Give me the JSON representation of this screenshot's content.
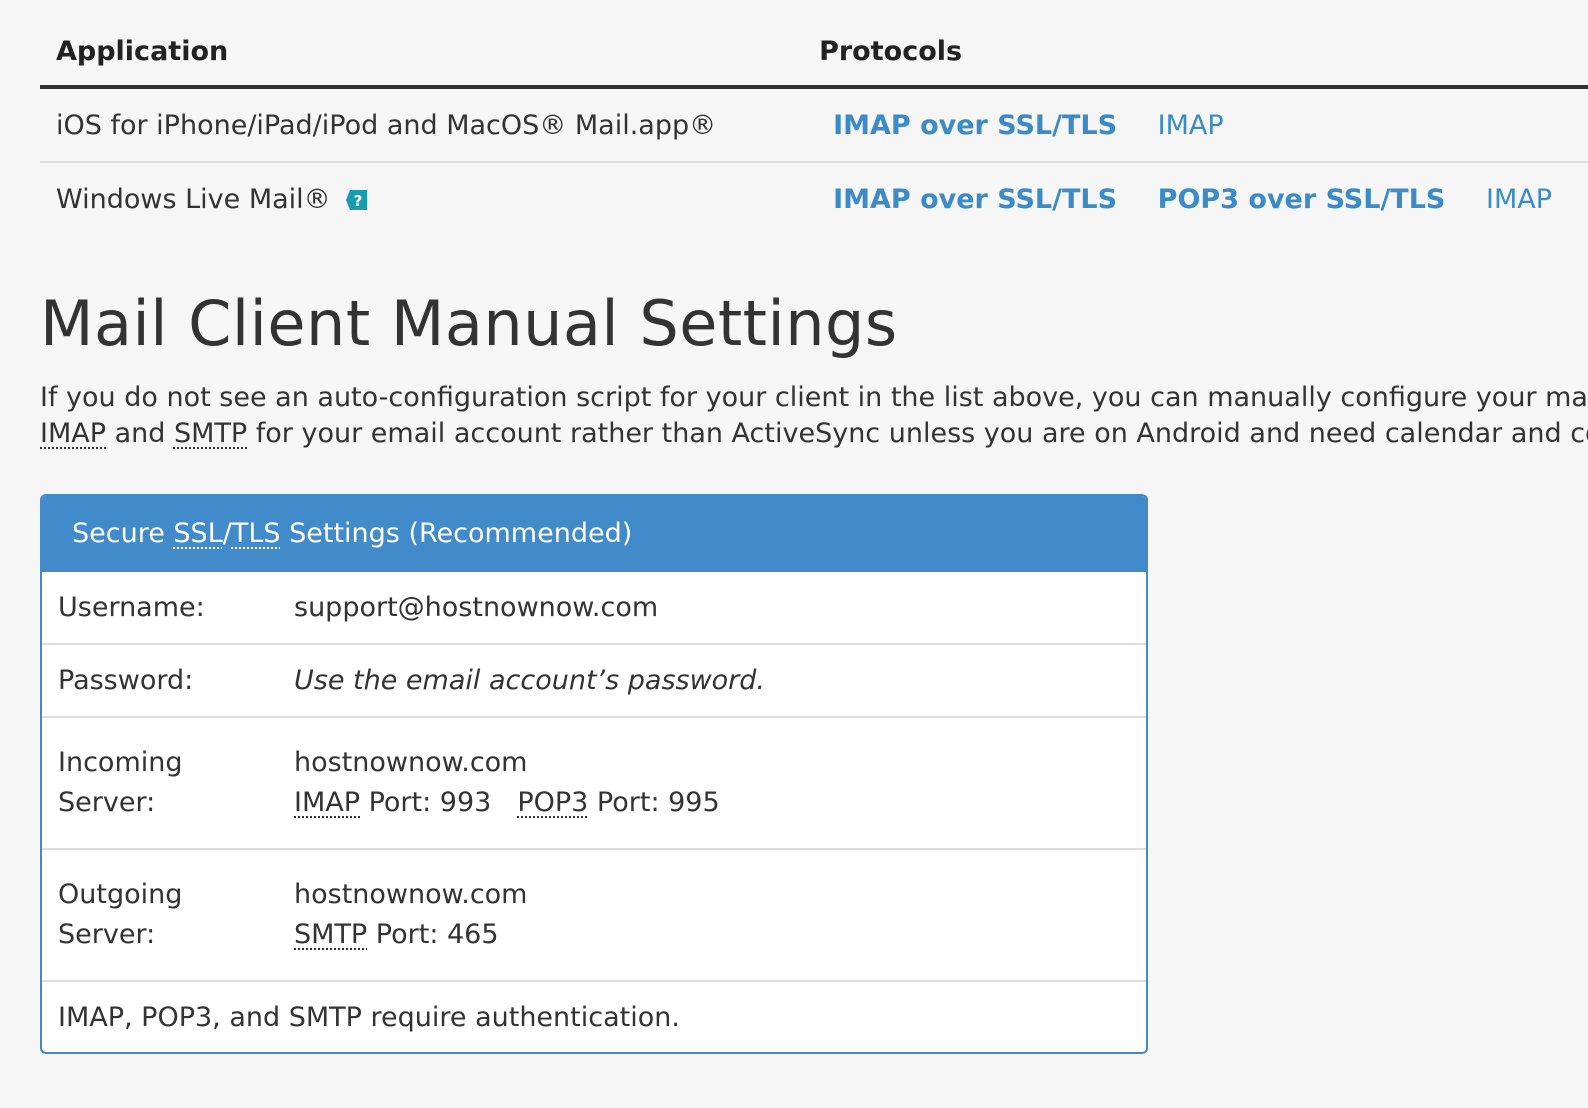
{
  "apps_table": {
    "headers": {
      "application": "Application",
      "protocols": "Protocols"
    },
    "rows": [
      {
        "application": "iOS for iPhone/iPad/iPod and MacOS® Mail.app®",
        "protocols": [
          {
            "label": "IMAP over SSL/TLS",
            "bold": true
          },
          {
            "label": "IMAP",
            "bold": false
          }
        ]
      },
      {
        "application": "Windows Live Mail®",
        "protocols": [
          {
            "label": "IMAP over SSL/TLS",
            "bold": true
          },
          {
            "label": "POP3 over SSL/TLS",
            "bold": true
          },
          {
            "label": "IMAP",
            "bold": false
          }
        ]
      }
    ]
  },
  "manual": {
    "title": "Mail Client Manual Settings",
    "intro_line1": "If you do not see an auto-configuration script for your client in the list above, you can manually configure your mail client",
    "intro_imap": "IMAP",
    "intro_and": " and ",
    "intro_smtp": "SMTP",
    "intro_line2_rest": " for your email account rather than ActiveSync unless you are on Android and need calendar and contacts"
  },
  "panel": {
    "heading_prefix": "Secure ",
    "heading_ssl": "SSL",
    "heading_slash": "/",
    "heading_tls": "TLS",
    "heading_suffix": " Settings (Recommended)",
    "username_label": "Username:",
    "username_value": "support@hostnownow.com",
    "password_label": "Password:",
    "password_value": "Use the email account’s password.",
    "incoming_label_1": "Incoming",
    "incoming_label_2": "Server:",
    "incoming_host": "hostnownow.com",
    "incoming_imap": "IMAP",
    "incoming_imap_port": " Port: 993",
    "incoming_pop3": "POP3",
    "incoming_pop3_port": " Port: 995",
    "outgoing_label_1": "Outgoing",
    "outgoing_label_2": "Server:",
    "outgoing_host": "hostnownow.com",
    "outgoing_smtp": "SMTP",
    "outgoing_smtp_port": " Port: 465",
    "footer": "IMAP, POP3, and SMTP require authentication."
  },
  "colors": {
    "link": "#3b8bc7",
    "panel_primary": "#428bca",
    "help_icon": "#1a9cb0"
  },
  "icons": {
    "help": "help-icon"
  }
}
